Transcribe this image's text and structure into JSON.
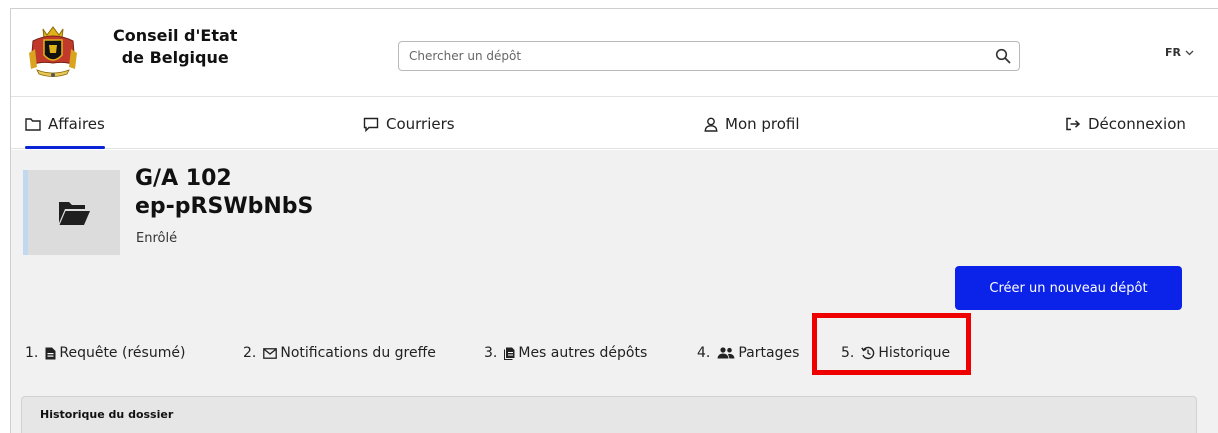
{
  "brand": {
    "line1": "Conseil d'Etat",
    "line2": "de Belgique"
  },
  "search": {
    "placeholder": "Chercher un dépôt"
  },
  "language": {
    "selected": "FR"
  },
  "nav": {
    "items": [
      {
        "label": "Affaires",
        "icon": "folder-icon",
        "active": true
      },
      {
        "label": "Courriers",
        "icon": "speech-bubble-icon"
      },
      {
        "label": "Mon profil",
        "icon": "user-icon"
      },
      {
        "label": "Déconnexion",
        "icon": "logout-icon"
      }
    ]
  },
  "case": {
    "reference": "G/A 102",
    "name": "ep-pRSWbNbS",
    "status": "Enrôlé"
  },
  "actions": {
    "new_deposit": "Créer un nouveau dépôt"
  },
  "tabs": [
    {
      "num": "1.",
      "label": "Requête (résumé)",
      "icon": "document-icon"
    },
    {
      "num": "2.",
      "label": "Notifications du greffe",
      "icon": "envelope-icon"
    },
    {
      "num": "3.",
      "label": "Mes autres dépôts",
      "icon": "documents-icon"
    },
    {
      "num": "4.",
      "label": "Partages",
      "icon": "users-icon"
    },
    {
      "num": "5.",
      "label": "Historique",
      "icon": "history-icon",
      "highlighted": true
    }
  ],
  "history": {
    "title": "Historique du dossier"
  },
  "colors": {
    "accent": "#0b23e8",
    "highlight": "#ee0000",
    "panel_bg": "#f1f1f1"
  }
}
